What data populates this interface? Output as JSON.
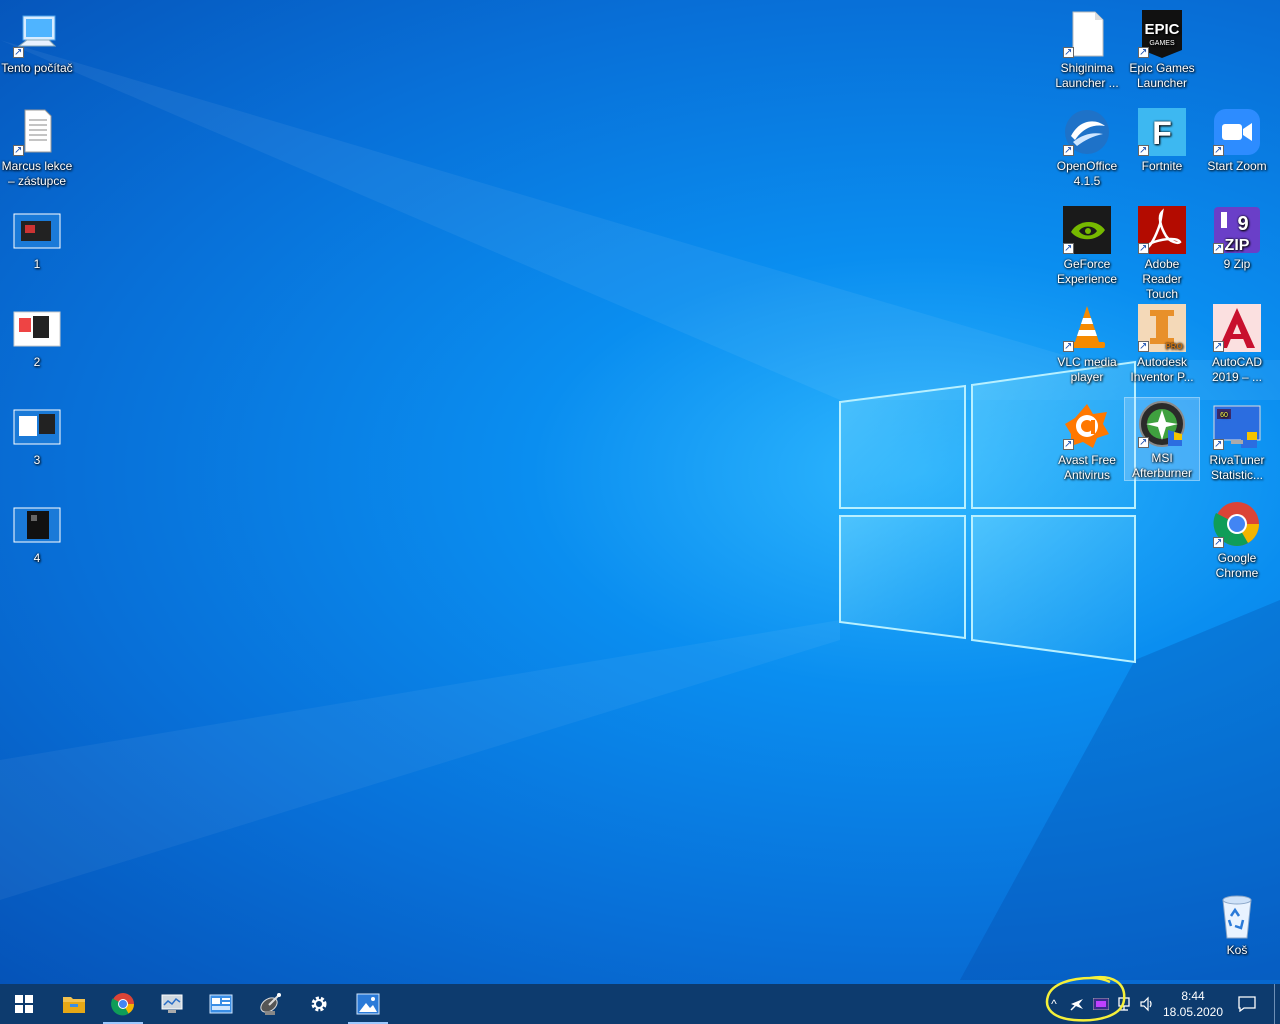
{
  "desktop": {
    "left_icons": [
      {
        "label": "Tento počítač",
        "icon": "computer-icon"
      },
      {
        "label": "Marcus lekce – zástupce",
        "icon": "document-icon"
      },
      {
        "label": "1",
        "icon": "screenshot-thumbnail-icon"
      },
      {
        "label": "2",
        "icon": "screenshot-thumbnail-icon"
      },
      {
        "label": "3",
        "icon": "screenshot-thumbnail-icon"
      },
      {
        "label": "4",
        "icon": "screenshot-thumbnail-icon"
      }
    ],
    "right_icons": [
      {
        "label": "Shiginima Launcher ...",
        "icon": "blank-file-icon"
      },
      {
        "label": "Epic Games Launcher",
        "icon": "epic-games-icon",
        "logo_text": "EPIC"
      },
      {
        "label": "OpenOffice 4.1.5",
        "icon": "openoffice-icon"
      },
      {
        "label": "Fortnite",
        "icon": "fortnite-icon",
        "logo_text": "F"
      },
      {
        "label": "Start Zoom",
        "icon": "zoom-icon"
      },
      {
        "label": "GeForce Experience",
        "icon": "nvidia-icon"
      },
      {
        "label": "Adobe Reader Touch",
        "icon": "adobe-reader-icon"
      },
      {
        "label": "9 Zip",
        "icon": "9zip-icon"
      },
      {
        "label": "VLC media player",
        "icon": "vlc-icon"
      },
      {
        "label": "Autodesk Inventor P...",
        "icon": "inventor-icon"
      },
      {
        "label": "AutoCAD 2019 – ...",
        "icon": "autocad-icon"
      },
      {
        "label": "Avast Free Antivirus",
        "icon": "avast-icon"
      },
      {
        "label": "MSI Afterburner",
        "icon": "msi-afterburner-icon",
        "selected": true
      },
      {
        "label": "RivaTuner Statistic...",
        "icon": "rivatuner-icon"
      },
      {
        "label": "Google Chrome",
        "icon": "chrome-icon"
      },
      {
        "label": "Koš",
        "icon": "recycle-bin-icon"
      }
    ]
  },
  "taskbar": {
    "pinned": [
      {
        "name": "start-button",
        "icon": "windows-logo-icon"
      },
      {
        "name": "file-explorer",
        "icon": "folder-icon"
      },
      {
        "name": "google-chrome",
        "icon": "chrome-icon"
      },
      {
        "name": "app-3",
        "icon": "monitor-app-icon"
      },
      {
        "name": "app-4",
        "icon": "control-panel-icon"
      },
      {
        "name": "app-5",
        "icon": "satellite-icon"
      },
      {
        "name": "settings",
        "icon": "gear-icon"
      },
      {
        "name": "photos",
        "icon": "photos-icon"
      }
    ],
    "tray": {
      "chevron": "^",
      "clock_time": "8:44",
      "clock_date": "18.05.2020"
    },
    "colors": {
      "taskbar": "#0d3b6e",
      "highlight_circle": "#f5f03a"
    }
  }
}
